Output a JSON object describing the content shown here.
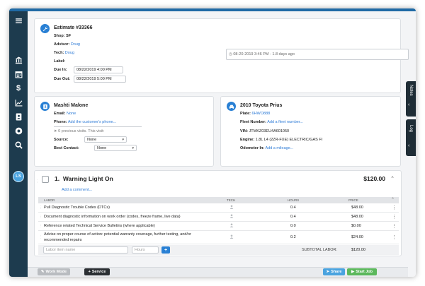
{
  "sidebar": {
    "items": [
      {
        "icon": "menu-icon"
      },
      {
        "icon": "bank-icon"
      },
      {
        "icon": "calendar-icon"
      },
      {
        "icon": "dollar-icon"
      },
      {
        "icon": "chart-icon"
      },
      {
        "icon": "contacts-icon"
      },
      {
        "icon": "tire-icon"
      },
      {
        "icon": "search-icon"
      }
    ],
    "avatar_initials": "LS"
  },
  "estimate": {
    "title": "Estimate #33366",
    "shop_label": "Shop:",
    "shop_value": "SF",
    "advisor_label": "Advisor:",
    "advisor_value": "Doug",
    "tech_label": "Tech:",
    "tech_value": "Doug",
    "label_label": "Label:",
    "due_in_label": "Due In:",
    "due_in_value": "08/22/2019 4:00 PM",
    "due_out_label": "Due Out:",
    "due_out_value": "08/22/2019 5:00 PM",
    "history_text": "08-20-2019 3:46 PM - 1.8 days ago"
  },
  "customer": {
    "name": "Mashti Malone",
    "email_label": "Email:",
    "email_value": "None",
    "phone_label": "Phone:",
    "phone_value": "Add the customer's phone...",
    "visits_text": "0 previous visits. This visit:",
    "source_label": "Source:",
    "source_value": "None",
    "contact_label": "Best Contact:",
    "contact_value": "None"
  },
  "vehicle": {
    "name": "2010 Toyota Prius",
    "plate_label": "Plate:",
    "plate_value": "6HWO888",
    "fleet_label": "Fleet Number:",
    "fleet_value": "Add a fleet number...",
    "vin_label": "VIN:",
    "vin_value": "JTMKZ03EU4A601050",
    "engine_label": "Engine:",
    "engine_value": "1.8L L4 (2ZR-FXE) ELECTRIC/GAS FI",
    "odometer_label": "Odometer In:",
    "odometer_value": "Add a mileage..."
  },
  "side_tabs": {
    "notes": "Notes",
    "log": "Log"
  },
  "service": {
    "number": "1.",
    "title": "Warning Light On",
    "price": "$120.00",
    "add_comment": "Add a comment...",
    "columns": {
      "labor": "LABOR",
      "tech": "TECH",
      "hours": "HOURS",
      "price": "PRICE"
    },
    "rows": [
      {
        "desc": "Pull Diagnostic Trouble Codes (DTCs)",
        "hours": "0.4",
        "price": "$48.00"
      },
      {
        "desc": "Document diagnostic information on work order (codes, freeze frame, live data)",
        "hours": "0.4",
        "price": "$48.00"
      },
      {
        "desc": "Reference related Technical Service Bulletins (where applicable)",
        "hours": "0.0",
        "price": "$0.00"
      },
      {
        "desc": "Advise on proper course of action: potential warranty coverage, further testing, and/or",
        "desc2": "recommended repairs",
        "hours": "0.2",
        "price": "$24.00"
      }
    ],
    "labor_placeholder": "Labor item name",
    "hours_placeholder": "Hours",
    "add_button": "+",
    "subtotal_label": "SUBTOTAL LABOR:",
    "subtotal_value": "$120.00"
  },
  "bottom_bar": {
    "work_mode": "Work Mode",
    "service": "Service",
    "share": "Share",
    "start_job": "Start Job"
  },
  "colors": {
    "accent": "#2980d4",
    "sidebar": "#1d3b4e",
    "share": "#4aa3df",
    "start": "#5cb85c"
  }
}
